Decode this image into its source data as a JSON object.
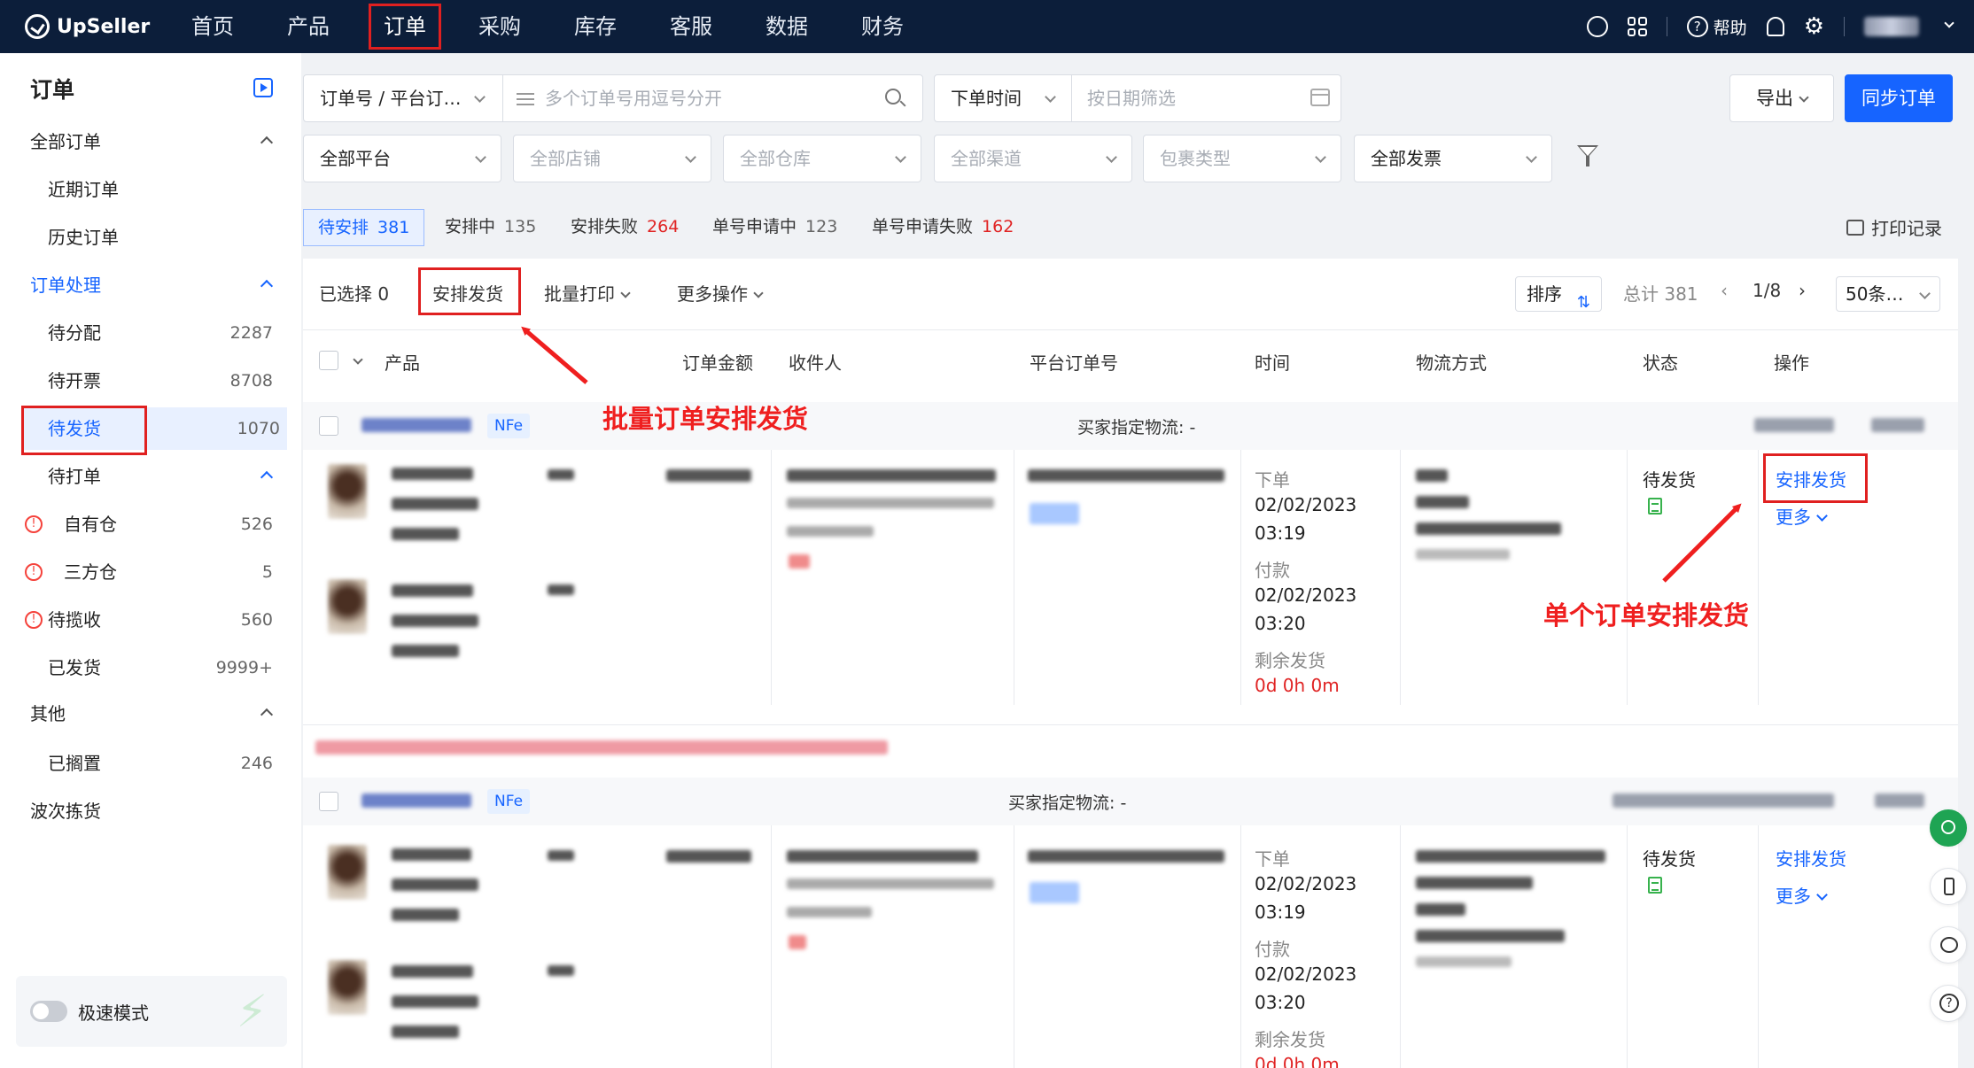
{
  "brand": "UpSeller",
  "nav": {
    "items": [
      "首页",
      "产品",
      "订单",
      "采购",
      "库存",
      "客服",
      "数据",
      "财务"
    ],
    "active": "订单",
    "help_label": "帮助"
  },
  "sidebar": {
    "title": "订单",
    "all_orders": "全部订单",
    "recent_orders": "近期订单",
    "history_orders": "历史订单",
    "order_processing": "订单处理",
    "to_assign": {
      "label": "待分配",
      "count": "2287"
    },
    "to_invoice": {
      "label": "待开票",
      "count": "8708"
    },
    "to_ship": {
      "label": "待发货",
      "count": "1070"
    },
    "to_print": "待打单",
    "own_warehouse": {
      "label": "自有仓",
      "count": "526"
    },
    "third_warehouse": {
      "label": "三方仓",
      "count": "5"
    },
    "to_collect": {
      "label": "待揽收",
      "count": "560"
    },
    "shipped": {
      "label": "已发货",
      "count": "9999+"
    },
    "other": "其他",
    "on_hold": {
      "label": "已搁置",
      "count": "246"
    },
    "wave_picking": "波次拣货",
    "speed_mode": "极速模式"
  },
  "filters": {
    "order_no_select": "订单号 / 平台订…",
    "order_no_placeholder": "多个订单号用逗号分开",
    "time_select": "下单时间",
    "date_placeholder": "按日期筛选",
    "export": "导出",
    "sync": "同步订单",
    "platform": "全部平台",
    "store": "全部店铺",
    "warehouse": "全部仓库",
    "channel": "全部渠道",
    "package_type": "包裹类型",
    "invoice": "全部发票"
  },
  "status_tabs": [
    {
      "label": "待安排",
      "count": "381",
      "red": false
    },
    {
      "label": "安排中",
      "count": "135",
      "red": false
    },
    {
      "label": "安排失败",
      "count": "264",
      "red": true
    },
    {
      "label": "单号申请中",
      "count": "123",
      "red": false
    },
    {
      "label": "单号申请失败",
      "count": "162",
      "red": true
    }
  ],
  "print_record": "打印记录",
  "toolbar": {
    "selected": "已选择 0",
    "arrange": "安排发货",
    "batch_print": "批量打印",
    "more_ops": "更多操作",
    "sort": "排序",
    "total": "总计 381",
    "page": "1/8",
    "per_page": "50条…"
  },
  "table_headers": [
    "产品",
    "订单金额",
    "收件人",
    "平台订单号",
    "时间",
    "物流方式",
    "状态",
    "操作"
  ],
  "orders": [
    {
      "tag": "NFe",
      "buyer_logistics": "买家指定物流: -",
      "time_labels": [
        "下单",
        "付款",
        "剩余发货"
      ],
      "order_date": "02/02/2023",
      "order_time": "03:19",
      "pay_date": "02/02/2023",
      "pay_time": "03:20",
      "remaining": "0d 0h 0m",
      "status": "待发货",
      "action": "安排发货",
      "more": "更多"
    },
    {
      "tag": "NFe",
      "buyer_logistics": "买家指定物流: -",
      "time_labels": [
        "下单",
        "付款",
        "剩余发货"
      ],
      "order_date": "02/02/2023",
      "order_time": "03:19",
      "pay_date": "02/02/2023",
      "pay_time": "03:20",
      "remaining": "0d 0h 0m",
      "status": "待发货",
      "action": "安排发货",
      "more": "更多"
    }
  ],
  "annotations": {
    "batch": "批量订单安排发货",
    "single": "单个订单安排发货"
  },
  "colors": {
    "nav_bg": "#0c1e3a",
    "primary": "#1664ff",
    "annotation_red": "#ef1f1f"
  }
}
